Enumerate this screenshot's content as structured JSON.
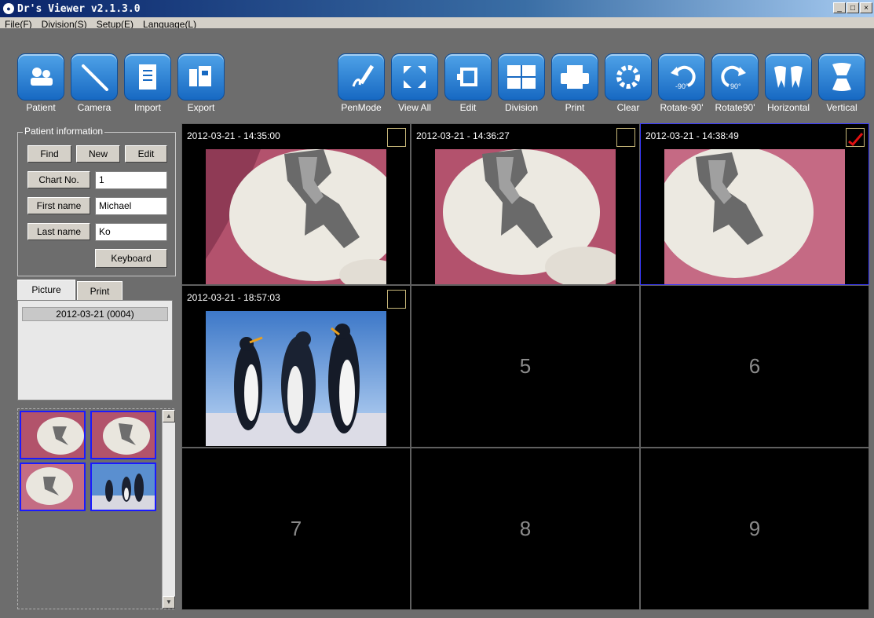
{
  "window": {
    "title": "Dr's Viewer v2.1.3.0",
    "min": "_",
    "max": "□",
    "close": "×"
  },
  "menu": [
    "File(F)",
    "Division(S)",
    "Setup(E)",
    "Language(L)"
  ],
  "toolbar": {
    "left": [
      {
        "label": "Patient",
        "icon": "patient-icon"
      },
      {
        "label": "Camera",
        "icon": "camera-icon"
      },
      {
        "label": "Import",
        "icon": "import-icon"
      },
      {
        "label": "Export",
        "icon": "export-icon"
      }
    ],
    "right": [
      {
        "label": "PenMode",
        "icon": "pen-icon"
      },
      {
        "label": "View All",
        "icon": "view-all-icon"
      },
      {
        "label": "Edit",
        "icon": "edit-icon"
      },
      {
        "label": "Division",
        "icon": "division-icon"
      },
      {
        "label": "Print",
        "icon": "print-icon"
      },
      {
        "label": "Clear",
        "icon": "clear-icon"
      },
      {
        "label": "Rotate-90'",
        "icon": "rotate-left-icon"
      },
      {
        "label": "Rotate90'",
        "icon": "rotate-right-icon"
      },
      {
        "label": "Horizontal",
        "icon": "flip-horizontal-icon"
      },
      {
        "label": "Vertical",
        "icon": "flip-vertical-icon"
      }
    ]
  },
  "patient": {
    "legend": "Patient information",
    "find": "Find",
    "new": "New",
    "edit": "Edit",
    "chart_label": "Chart No.",
    "chart_value": "1",
    "first_label": "First name",
    "first_value": "Michael",
    "last_label": "Last name",
    "last_value": "Ko",
    "keyboard": "Keyboard"
  },
  "tabs": {
    "picture": "Picture",
    "print": "Print"
  },
  "date_list": [
    "2012-03-21 (0004)"
  ],
  "cells": [
    {
      "stamp": "2012-03-21 - 14:35:00",
      "checked": false
    },
    {
      "stamp": "2012-03-21 - 14:36:27",
      "checked": false
    },
    {
      "stamp": "2012-03-21 - 14:38:49",
      "checked": true
    },
    {
      "stamp": "2012-03-21 - 18:57:03",
      "checked": false
    },
    {
      "num": "5"
    },
    {
      "num": "6"
    },
    {
      "num": "7"
    },
    {
      "num": "8"
    },
    {
      "num": "9"
    }
  ]
}
